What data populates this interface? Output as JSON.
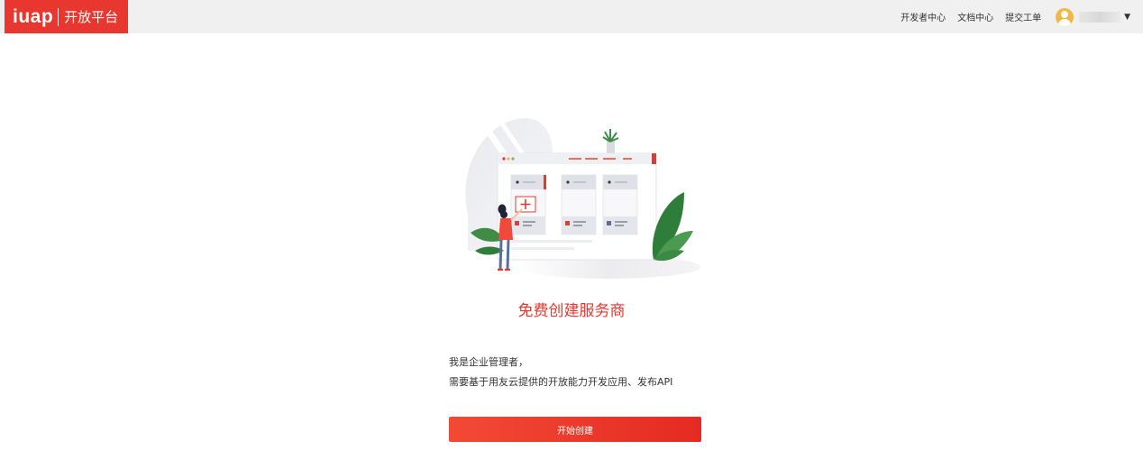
{
  "brand": {
    "logo_text": "iuap",
    "subtitle": "开放平台",
    "color": "#e8372f"
  },
  "nav": {
    "links": [
      "开发者中心",
      "文档中心",
      "提交工单"
    ],
    "user_menu_icon": "caret-down-icon"
  },
  "main": {
    "title": "免费创建服务商",
    "desc_line1": "我是企业管理者，",
    "desc_line2": "需要基于用友云提供的开放能力开发应用、发布API",
    "button_label": "开始创建"
  }
}
